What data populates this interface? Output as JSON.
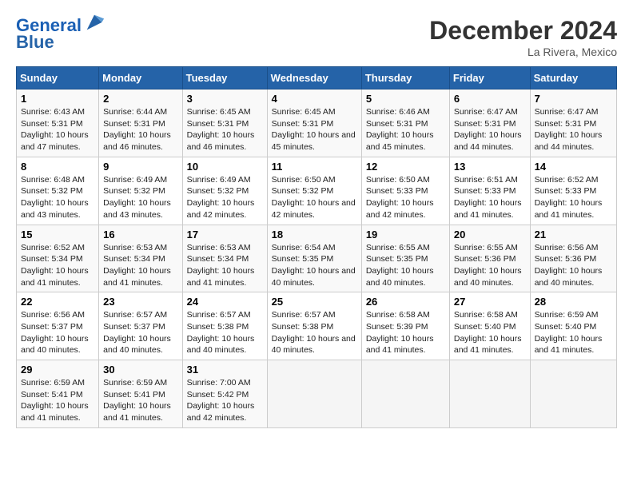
{
  "header": {
    "logo_line1": "General",
    "logo_line2": "Blue",
    "month": "December 2024",
    "location": "La Rivera, Mexico"
  },
  "weekdays": [
    "Sunday",
    "Monday",
    "Tuesday",
    "Wednesday",
    "Thursday",
    "Friday",
    "Saturday"
  ],
  "weeks": [
    [
      {
        "day": "1",
        "rise": "6:43 AM",
        "set": "5:31 PM",
        "daylight": "10 hours and 47 minutes."
      },
      {
        "day": "2",
        "rise": "6:44 AM",
        "set": "5:31 PM",
        "daylight": "10 hours and 46 minutes."
      },
      {
        "day": "3",
        "rise": "6:45 AM",
        "set": "5:31 PM",
        "daylight": "10 hours and 46 minutes."
      },
      {
        "day": "4",
        "rise": "6:45 AM",
        "set": "5:31 PM",
        "daylight": "10 hours and 45 minutes."
      },
      {
        "day": "5",
        "rise": "6:46 AM",
        "set": "5:31 PM",
        "daylight": "10 hours and 45 minutes."
      },
      {
        "day": "6",
        "rise": "6:47 AM",
        "set": "5:31 PM",
        "daylight": "10 hours and 44 minutes."
      },
      {
        "day": "7",
        "rise": "6:47 AM",
        "set": "5:31 PM",
        "daylight": "10 hours and 44 minutes."
      }
    ],
    [
      {
        "day": "8",
        "rise": "6:48 AM",
        "set": "5:32 PM",
        "daylight": "10 hours and 43 minutes."
      },
      {
        "day": "9",
        "rise": "6:49 AM",
        "set": "5:32 PM",
        "daylight": "10 hours and 43 minutes."
      },
      {
        "day": "10",
        "rise": "6:49 AM",
        "set": "5:32 PM",
        "daylight": "10 hours and 42 minutes."
      },
      {
        "day": "11",
        "rise": "6:50 AM",
        "set": "5:32 PM",
        "daylight": "10 hours and 42 minutes."
      },
      {
        "day": "12",
        "rise": "6:50 AM",
        "set": "5:33 PM",
        "daylight": "10 hours and 42 minutes."
      },
      {
        "day": "13",
        "rise": "6:51 AM",
        "set": "5:33 PM",
        "daylight": "10 hours and 41 minutes."
      },
      {
        "day": "14",
        "rise": "6:52 AM",
        "set": "5:33 PM",
        "daylight": "10 hours and 41 minutes."
      }
    ],
    [
      {
        "day": "15",
        "rise": "6:52 AM",
        "set": "5:34 PM",
        "daylight": "10 hours and 41 minutes."
      },
      {
        "day": "16",
        "rise": "6:53 AM",
        "set": "5:34 PM",
        "daylight": "10 hours and 41 minutes."
      },
      {
        "day": "17",
        "rise": "6:53 AM",
        "set": "5:34 PM",
        "daylight": "10 hours and 41 minutes."
      },
      {
        "day": "18",
        "rise": "6:54 AM",
        "set": "5:35 PM",
        "daylight": "10 hours and 40 minutes."
      },
      {
        "day": "19",
        "rise": "6:55 AM",
        "set": "5:35 PM",
        "daylight": "10 hours and 40 minutes."
      },
      {
        "day": "20",
        "rise": "6:55 AM",
        "set": "5:36 PM",
        "daylight": "10 hours and 40 minutes."
      },
      {
        "day": "21",
        "rise": "6:56 AM",
        "set": "5:36 PM",
        "daylight": "10 hours and 40 minutes."
      }
    ],
    [
      {
        "day": "22",
        "rise": "6:56 AM",
        "set": "5:37 PM",
        "daylight": "10 hours and 40 minutes."
      },
      {
        "day": "23",
        "rise": "6:57 AM",
        "set": "5:37 PM",
        "daylight": "10 hours and 40 minutes."
      },
      {
        "day": "24",
        "rise": "6:57 AM",
        "set": "5:38 PM",
        "daylight": "10 hours and 40 minutes."
      },
      {
        "day": "25",
        "rise": "6:57 AM",
        "set": "5:38 PM",
        "daylight": "10 hours and 40 minutes."
      },
      {
        "day": "26",
        "rise": "6:58 AM",
        "set": "5:39 PM",
        "daylight": "10 hours and 41 minutes."
      },
      {
        "day": "27",
        "rise": "6:58 AM",
        "set": "5:40 PM",
        "daylight": "10 hours and 41 minutes."
      },
      {
        "day": "28",
        "rise": "6:59 AM",
        "set": "5:40 PM",
        "daylight": "10 hours and 41 minutes."
      }
    ],
    [
      {
        "day": "29",
        "rise": "6:59 AM",
        "set": "5:41 PM",
        "daylight": "10 hours and 41 minutes."
      },
      {
        "day": "30",
        "rise": "6:59 AM",
        "set": "5:41 PM",
        "daylight": "10 hours and 41 minutes."
      },
      {
        "day": "31",
        "rise": "7:00 AM",
        "set": "5:42 PM",
        "daylight": "10 hours and 42 minutes."
      },
      null,
      null,
      null,
      null
    ]
  ]
}
